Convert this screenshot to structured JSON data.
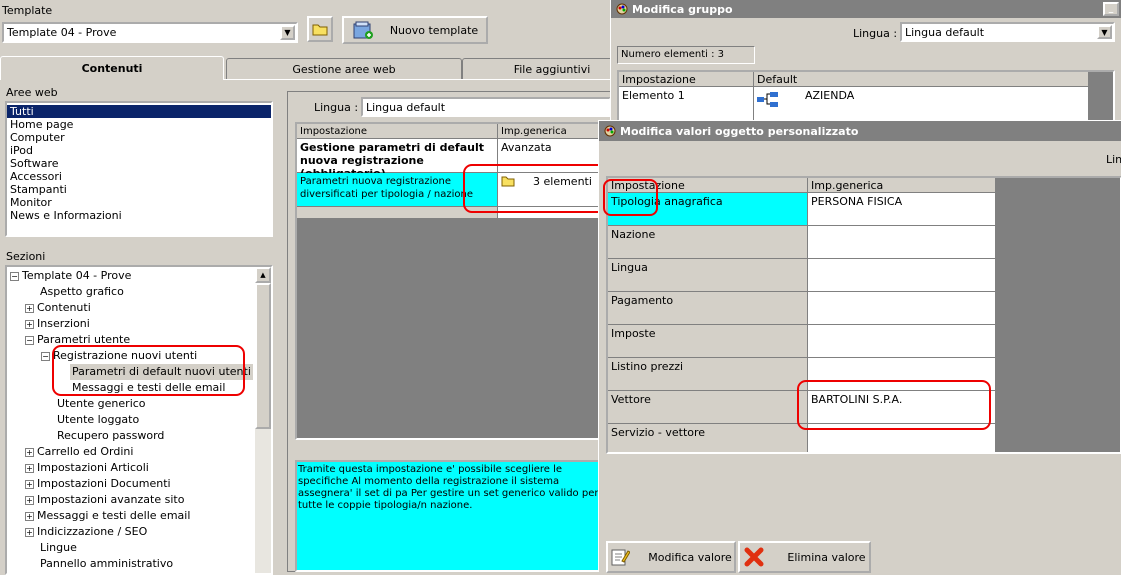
{
  "template": {
    "group_label": "Template",
    "selected": "Template 04 - Prove",
    "new_button": "Nuovo template"
  },
  "tabs": [
    "Contenuti",
    "Gestione aree web",
    "File aggiuntivi"
  ],
  "aree_web": {
    "label": "Aree web",
    "items": [
      "Tutti",
      "Home page",
      "Computer",
      "iPod",
      "Software",
      "Accessori",
      "Stampanti",
      "Monitor",
      "News e Informazioni"
    ]
  },
  "sezioni": {
    "label": "Sezioni",
    "root": "Template 04 - Prove",
    "items": {
      "aspetto": "Aspetto grafico",
      "contenuti": "Contenuti",
      "inserzioni": "Inserzioni",
      "parametri": "Parametri utente",
      "registrazione": "Registrazione nuovi utenti",
      "param_default": "Parametri di default nuovi utenti",
      "messaggi_email": "Messaggi e testi delle email",
      "utente_generico": "Utente generico",
      "utente_loggato": "Utente loggato",
      "recupero": "Recupero password",
      "carrello": "Carrello ed Ordini",
      "articoli": "Impostazioni Articoli",
      "documenti": "Impostazioni Documenti",
      "avanzate": "Impostazioni avanzate sito",
      "messaggi": "Messaggi e testi delle email",
      "seo": "Indicizzazione / SEO",
      "lingue": "Lingue",
      "pannello": "Pannello amministrativo"
    }
  },
  "center": {
    "lingua_label": "Lingua :",
    "lingua_value": "Lingua default",
    "col_impostazione": "Impostazione",
    "col_generica": "Imp.generica",
    "row1_title": "Gestione parametri di default nuova registrazione (obbligatorio)",
    "row1_value": "Avanzata",
    "row2_title": "Parametri nuova registrazione diversificati per tipologia / nazione",
    "row2_value": "3 elementi",
    "description": "Tramite questa impostazione e' possibile scegliere le specifiche Al momento della registrazione il sistema assegnera' il set di pa Per gestire un set generico valido per tutte le coppie tipologia/n nazione."
  },
  "modifica_gruppo": {
    "title": "Modifica gruppo",
    "lingua_label": "Lingua :",
    "lingua_value": "Lingua default",
    "numero_elementi": "Numero elementi : 3",
    "col_impostazione": "Impostazione",
    "col_default": "Default",
    "row_label": "Elemento 1",
    "row_value": "AZIENDA"
  },
  "modifica_valori": {
    "title": "Modifica valori oggetto personalizzato",
    "lingua_partial": "Ling",
    "col_impostazione": "Impostazione",
    "col_generica": "Imp.generica",
    "rows": [
      {
        "label": "Tipologia anagrafica",
        "value": "PERSONA FISICA"
      },
      {
        "label": "Nazione",
        "value": ""
      },
      {
        "label": "Lingua",
        "value": ""
      },
      {
        "label": "Pagamento",
        "value": ""
      },
      {
        "label": "Imposte",
        "value": ""
      },
      {
        "label": "Listino prezzi",
        "value": ""
      },
      {
        "label": "Vettore",
        "value": "BARTOLINI S.P.A."
      },
      {
        "label": "Servizio - vettore",
        "value": ""
      }
    ],
    "btn_modifica": "Modifica valore",
    "btn_elimina": "Elimina valore"
  },
  "colors": {
    "selection": "#0a246a",
    "cyan": "#00ffff",
    "highlight_red": "#e00000",
    "titlebar": "#808080"
  }
}
